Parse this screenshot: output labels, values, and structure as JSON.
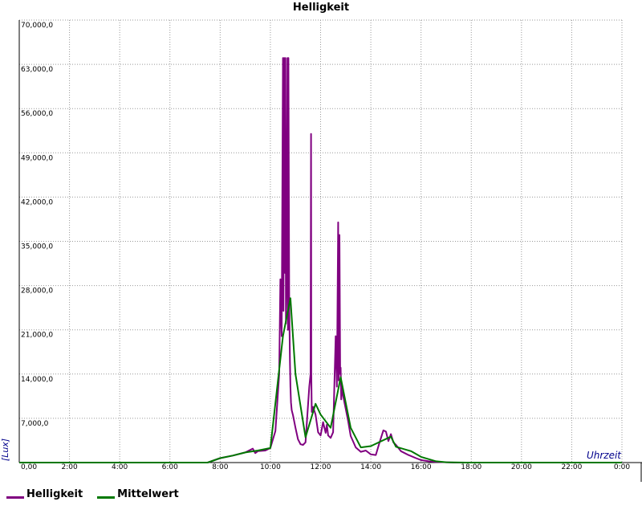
{
  "chart_data": {
    "type": "line",
    "title": "Helligkeit",
    "xlabel": "Uhrzeit",
    "ylabel": "[Lux]",
    "xlim": [
      0,
      24
    ],
    "ylim": [
      0,
      70000
    ],
    "grid": true,
    "legend": "bottom-left",
    "x_ticks": [
      {
        "value": 0,
        "label": "0,00"
      },
      {
        "value": 2,
        "label": "2:00"
      },
      {
        "value": 4,
        "label": "4:00"
      },
      {
        "value": 6,
        "label": "6:00"
      },
      {
        "value": 8,
        "label": "8:00"
      },
      {
        "value": 10,
        "label": "10:00"
      },
      {
        "value": 12,
        "label": "12:00"
      },
      {
        "value": 14,
        "label": "14:00"
      },
      {
        "value": 16,
        "label": "16:00"
      },
      {
        "value": 18,
        "label": "18:00"
      },
      {
        "value": 20,
        "label": "20:00"
      },
      {
        "value": 22,
        "label": "22:00"
      },
      {
        "value": 24,
        "label": "0:00"
      }
    ],
    "y_ticks": [
      {
        "value": 7000,
        "label": "7,000,0"
      },
      {
        "value": 14000,
        "label": "14,000,0"
      },
      {
        "value": 21000,
        "label": "21,000,0"
      },
      {
        "value": 28000,
        "label": "28,000,0"
      },
      {
        "value": 35000,
        "label": "35,000,0"
      },
      {
        "value": 42000,
        "label": "42,000,0"
      },
      {
        "value": 49000,
        "label": "49,000,0"
      },
      {
        "value": 56000,
        "label": "56,000,0"
      },
      {
        "value": 63000,
        "label": "63,000,0"
      },
      {
        "value": 70000,
        "label": "70,000,0"
      }
    ],
    "series": [
      {
        "name": "Helligkeit",
        "color": "#800080",
        "x": [
          0,
          7.5,
          8.0,
          8.5,
          9.0,
          9.3,
          9.4,
          9.5,
          9.8,
          10.0,
          10.2,
          10.35,
          10.4,
          10.45,
          10.5,
          10.52,
          10.55,
          10.58,
          10.6,
          10.62,
          10.65,
          10.68,
          10.7,
          10.72,
          10.75,
          10.78,
          10.8,
          10.82,
          10.85,
          10.9,
          11.0,
          11.1,
          11.2,
          11.3,
          11.4,
          11.55,
          11.6,
          11.62,
          11.63,
          11.65,
          11.7,
          11.8,
          11.9,
          12.0,
          12.1,
          12.2,
          12.25,
          12.3,
          12.4,
          12.5,
          12.6,
          12.65,
          12.7,
          12.72,
          12.75,
          12.78,
          12.8,
          12.82,
          12.85,
          12.9,
          12.95,
          13.0,
          13.1,
          13.2,
          13.4,
          13.6,
          13.8,
          14.0,
          14.2,
          14.35,
          14.5,
          14.6,
          14.7,
          14.8,
          14.9,
          15.0,
          15.2,
          15.5,
          15.8,
          16.0,
          16.3,
          16.6,
          17.0,
          17.3,
          17.8,
          18.2,
          24
        ],
        "y": [
          0,
          0,
          700,
          1100,
          1600,
          2200,
          1500,
          1800,
          1900,
          2300,
          5000,
          14000,
          29000,
          20000,
          64000,
          24000,
          64000,
          30000,
          64000,
          22000,
          32000,
          64000,
          21000,
          64000,
          25000,
          16000,
          12000,
          9500,
          8300,
          7500,
          5500,
          3700,
          2900,
          2800,
          3200,
          12000,
          14000,
          52000,
          14000,
          8000,
          8800,
          7600,
          4800,
          4300,
          6400,
          4700,
          6000,
          4300,
          3900,
          4800,
          20000,
          12000,
          38000,
          13000,
          36000,
          14000,
          15000,
          10000,
          12000,
          10500,
          9500,
          8500,
          6500,
          4200,
          2400,
          1700,
          1900,
          1300,
          1200,
          3200,
          5100,
          4900,
          3400,
          4500,
          3200,
          2800,
          1800,
          1200,
          700,
          400,
          200,
          100,
          50,
          0,
          0,
          0,
          0
        ]
      },
      {
        "name": "Mittelwert",
        "color": "#007800",
        "x": [
          0,
          7.5,
          8.0,
          8.5,
          9.0,
          9.5,
          10.0,
          10.5,
          10.8,
          11.0,
          11.4,
          11.8,
          12.0,
          12.4,
          12.8,
          13.2,
          13.6,
          14.0,
          14.8,
          15.0,
          15.6,
          16.0,
          16.6,
          17.0,
          17.8,
          24
        ],
        "y": [
          0,
          0,
          700,
          1100,
          1600,
          1900,
          2300,
          20000,
          26000,
          14000,
          4000,
          9300,
          7600,
          5500,
          13500,
          5500,
          2400,
          2600,
          4100,
          2500,
          1800,
          900,
          200,
          50,
          0,
          0
        ]
      }
    ]
  }
}
